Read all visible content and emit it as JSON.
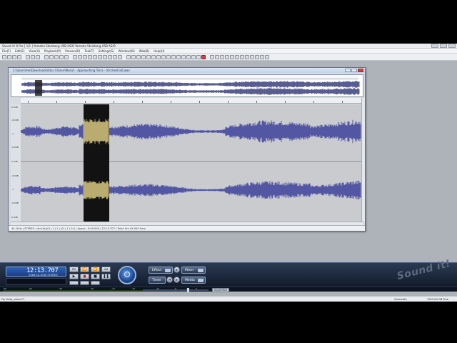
{
  "app": {
    "title": "Sound it! 8 Pro   [ 1/1 ]   Yamaha Steinberg USB ASIO   Yamaha Steinberg USB ASIO",
    "menu": [
      "File(F)",
      "Edit(E)",
      "View(V)",
      "Playback(P)",
      "Process(R)",
      "Tool(T)",
      "Settings(S)",
      "Window(W)",
      "Web(B)",
      "Help(H)"
    ]
  },
  "document": {
    "title": "C:\\Users\\me\\Downloads\\Star Citizen\\Music\\ - Approaching Terra - [Orchestral].wav",
    "y_labels": [
      "0.0dB",
      "-6.0dB",
      "-∞",
      "-6.0dB",
      "0.0dB",
      "-6.0dB",
      "-∞",
      "-6.0dB",
      "0.0dB"
    ],
    "status": "44.1kHz  |  STEREO  |  4m(3s)(0)  |  1  |  1  |  (0)  |  1  |  0.0  |  Space : 0:00.000 / 12:13.707  |  Total: 6m 44.000 Smp"
  },
  "transport": {
    "time": "12:13.707",
    "format": "24bit  44.1000  STEREO",
    "effect_label": "Effect",
    "mixer_label": "Mixer",
    "timer_label": "Timer",
    "media_label": "Media",
    "input_mon_label": "Input Mon",
    "logo": "Sound it!"
  },
  "meter_scale": [
    "-96",
    "-60",
    "-48",
    "-36",
    "-24",
    "-18",
    "-12",
    "-6",
    "-3",
    "0"
  ],
  "statusbar": {
    "left": "For Help, press F1",
    "mode": "Overwrite",
    "free": "1922.84 GB Free"
  },
  "colors": {
    "wave": "#5256a3",
    "wave_dark": "#2f3474",
    "selection_bg": "#121212",
    "selection_wave": "#b9ac6e",
    "panel": "#1b263a"
  }
}
